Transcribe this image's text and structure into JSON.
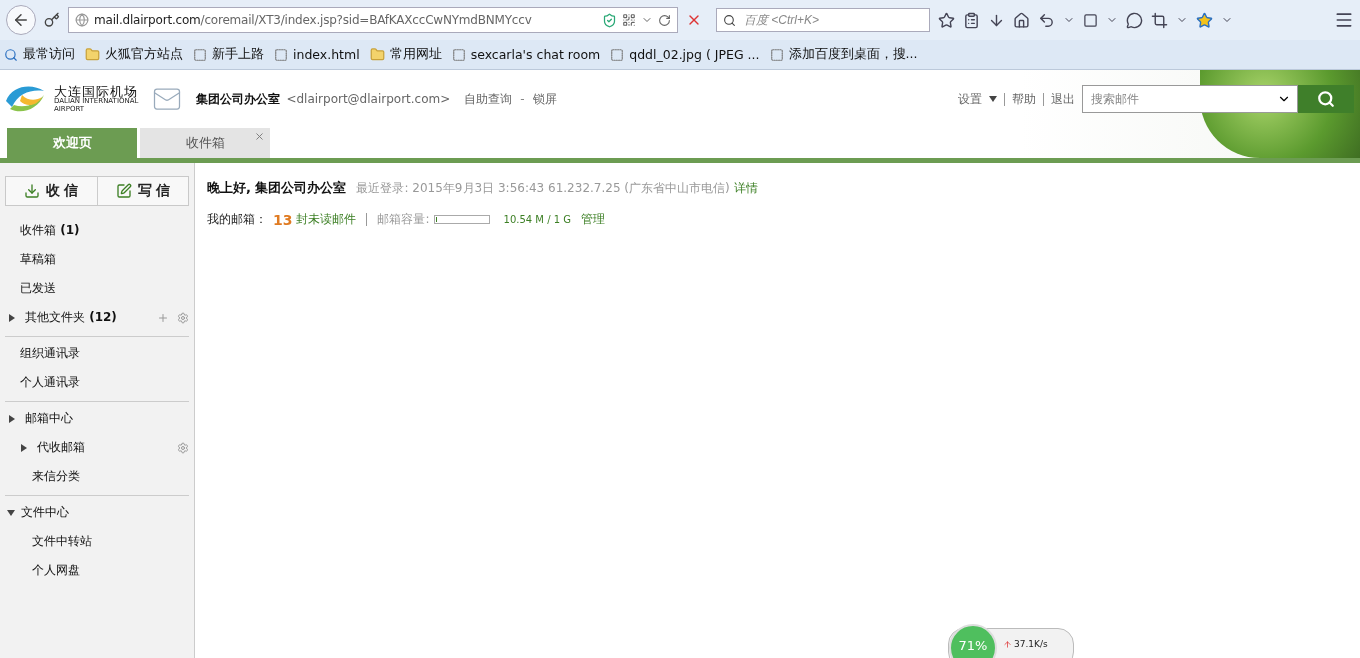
{
  "browser": {
    "url_host": "mail.dlairport.com",
    "url_path": "/coremail/XT3/index.jsp?sid=BAfKAXccCwNYmdBNMYccv",
    "search_placeholder": "百度 <Ctrl+K>",
    "bookmarks": [
      {
        "label": "最常访问",
        "kind": "special"
      },
      {
        "label": "火狐官方站点",
        "kind": "folder"
      },
      {
        "label": "新手上路",
        "kind": "page"
      },
      {
        "label": "index.html",
        "kind": "page"
      },
      {
        "label": "常用网址",
        "kind": "folder"
      },
      {
        "label": "sexcarla's chat room",
        "kind": "page"
      },
      {
        "label": "qddl_02.jpg ( JPEG ...",
        "kind": "page"
      },
      {
        "label": "添加百度到桌面，搜...",
        "kind": "page"
      }
    ]
  },
  "header": {
    "logo_cn": "大连国际机场",
    "logo_en1": "DALIAN INTERNATIONAL",
    "logo_en2": "AIRPORT",
    "user_name": "集团公司办公室",
    "user_email": "<dlairport@dlairport.com>",
    "links": [
      "自助查询",
      "锁屏"
    ],
    "link_sep": "-",
    "settings": "设置",
    "help": "帮助",
    "logout": "退出",
    "search_placeholder": "搜索邮件"
  },
  "tabs": [
    {
      "label": "欢迎页",
      "selected": true,
      "closable": false
    },
    {
      "label": "收件箱",
      "selected": false,
      "closable": true
    }
  ],
  "sidebar": {
    "receive": "收 信",
    "compose": "写 信",
    "sections": [
      {
        "items": [
          {
            "label": "收件箱",
            "count": "(1)",
            "kind": "link"
          },
          {
            "label": "草稿箱",
            "kind": "link"
          },
          {
            "label": "已发送",
            "kind": "link"
          },
          {
            "label": "其他文件夹",
            "count": "(12)",
            "kind": "group",
            "expanded": false,
            "add": true,
            "gear": true
          }
        ]
      },
      {
        "items": [
          {
            "label": "组织通讯录",
            "kind": "link"
          },
          {
            "label": "个人通讯录",
            "kind": "link"
          }
        ]
      },
      {
        "items": [
          {
            "label": "邮箱中心",
            "kind": "group",
            "expanded": false,
            "children": [
              {
                "label": "代收邮箱",
                "kind": "group",
                "expanded": false,
                "gear": true
              },
              {
                "label": "来信分类",
                "kind": "link"
              }
            ]
          }
        ]
      },
      {
        "items": [
          {
            "label": "文件中心",
            "kind": "group",
            "expanded": true,
            "children": [
              {
                "label": "文件中转站",
                "kind": "link"
              },
              {
                "label": "个人网盘",
                "kind": "link"
              }
            ]
          }
        ]
      }
    ]
  },
  "welcome": {
    "greeting": "晚上好, 集团公司办公室",
    "last_login": "最近登录: 2015年9月3日 3:56:43 61.232.7.25 (广东省中山市电信)",
    "details": "详情",
    "mailbox_label": "我的邮箱：",
    "unread_count": "13",
    "unread_label": "封未读邮件",
    "capacity_label": "邮箱容量:",
    "capacity": {
      "level": 0.01
    },
    "capacity_text": "10.54 M / 1 G",
    "manage": "管理"
  },
  "net_widget": {
    "percent": "71%",
    "speed": "37.1K/s"
  }
}
